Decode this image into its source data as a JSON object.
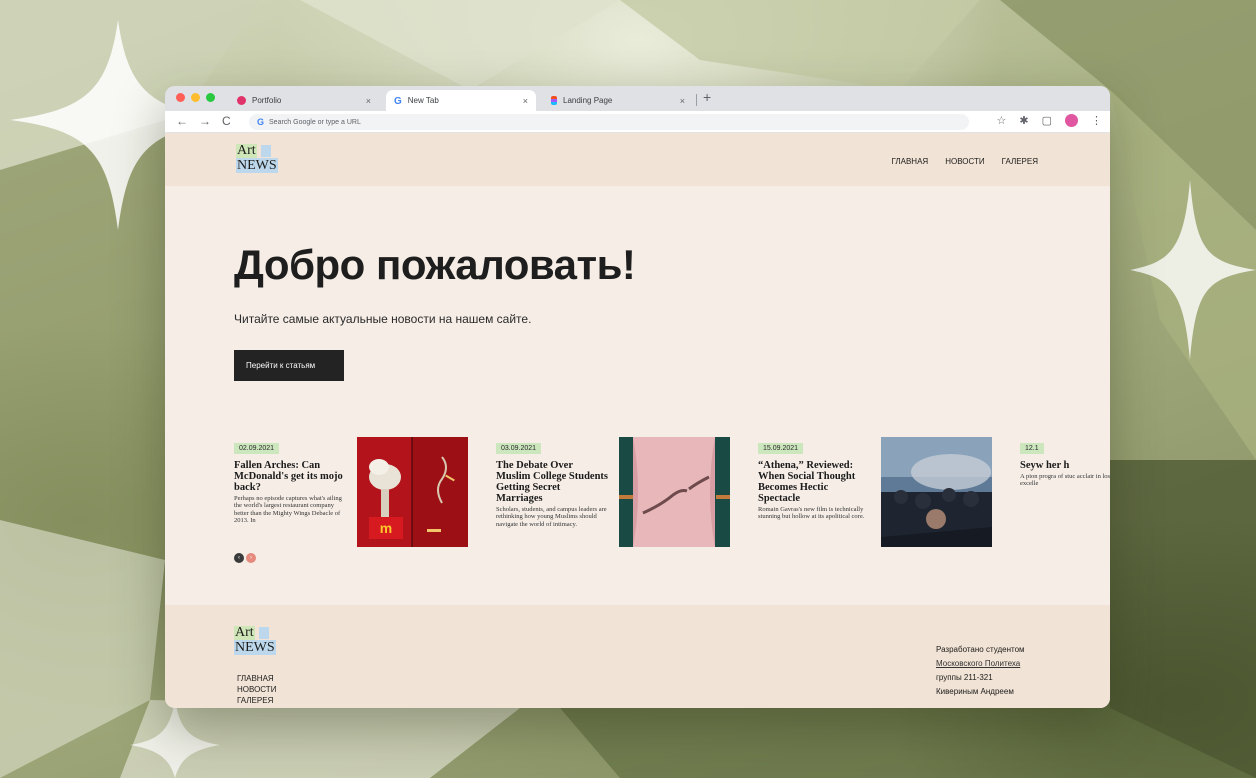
{
  "colors": {
    "page_bg": "#f5ede6",
    "header_bg": "#f1e3d6",
    "date_badge": "#cce7bd",
    "cta_bg": "#232323"
  },
  "browser": {
    "tabs": [
      {
        "title": "Portfolio",
        "icon": "portfolio-favicon",
        "color": "#e0336a",
        "active": false
      },
      {
        "title": "New Tab",
        "icon": "google-favicon",
        "color": "#4285f4",
        "active": true
      },
      {
        "title": "Landing Page",
        "icon": "figma-favicon",
        "color": "#f24e1e",
        "active": false
      }
    ],
    "close_glyph": "×",
    "new_tab_glyph": "+",
    "omnibox_placeholder": "Search Google or type a URL",
    "google_glyph": "G"
  },
  "site": {
    "logo": {
      "line1": "Art",
      "line2": "NEWS"
    },
    "nav": [
      "ГЛАВНАЯ",
      "НОВОСТИ",
      "ГАЛЕРЕЯ"
    ],
    "hero": {
      "title": "Добро пожаловать!",
      "subtitle": "Читайте самые актуальные новости на нашем сайте.",
      "cta": "Перейти к статьям"
    },
    "articles": [
      {
        "date": "02.09.2021",
        "title": "Fallen Arches: Can McDonald's get its mojo back?",
        "desc": "Perhaps no episode captures what's ailing the world's largest restaurant company better than the Mighty Wings Debacle of 2013. In"
      },
      {
        "date": "03.09.2021",
        "title": "The Debate Over Muslim College Students Getting Secret Marriages",
        "desc": "Scholars, students, and campus leaders are rethinking how young Muslims should navigate the world of intimacy."
      },
      {
        "date": "15.09.2021",
        "title": "“Athena,” Reviewed: When Social Thought Becomes Hectic Spectacle",
        "desc": "Romain Gavras's new film is technically stunning but hollow at its apolitical core."
      },
      {
        "date": "12.1",
        "title": "Seyw her h",
        "desc": "A pion progra of stuc acclair in los a excelle"
      }
    ],
    "footer": {
      "nav": [
        "ГЛАВНАЯ",
        "НОВОСТИ",
        "ГАЛЕРЕЯ"
      ],
      "credits": {
        "line1": "Разработано студентом",
        "line2": "Московского Политеха",
        "line3": "группы 211-321",
        "line4": "Кивериным Андреем"
      }
    }
  }
}
